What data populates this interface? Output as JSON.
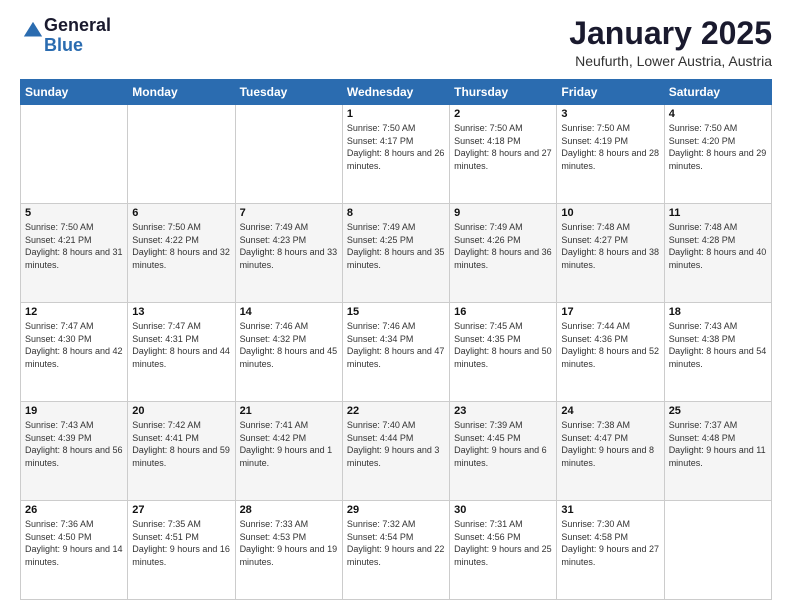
{
  "header": {
    "logo_general": "General",
    "logo_blue": "Blue",
    "month_title": "January 2025",
    "location": "Neufurth, Lower Austria, Austria"
  },
  "days_of_week": [
    "Sunday",
    "Monday",
    "Tuesday",
    "Wednesday",
    "Thursday",
    "Friday",
    "Saturday"
  ],
  "weeks": [
    [
      {
        "day": "",
        "content": ""
      },
      {
        "day": "",
        "content": ""
      },
      {
        "day": "",
        "content": ""
      },
      {
        "day": "1",
        "content": "Sunrise: 7:50 AM\nSunset: 4:17 PM\nDaylight: 8 hours and 26 minutes."
      },
      {
        "day": "2",
        "content": "Sunrise: 7:50 AM\nSunset: 4:18 PM\nDaylight: 8 hours and 27 minutes."
      },
      {
        "day": "3",
        "content": "Sunrise: 7:50 AM\nSunset: 4:19 PM\nDaylight: 8 hours and 28 minutes."
      },
      {
        "day": "4",
        "content": "Sunrise: 7:50 AM\nSunset: 4:20 PM\nDaylight: 8 hours and 29 minutes."
      }
    ],
    [
      {
        "day": "5",
        "content": "Sunrise: 7:50 AM\nSunset: 4:21 PM\nDaylight: 8 hours and 31 minutes."
      },
      {
        "day": "6",
        "content": "Sunrise: 7:50 AM\nSunset: 4:22 PM\nDaylight: 8 hours and 32 minutes."
      },
      {
        "day": "7",
        "content": "Sunrise: 7:49 AM\nSunset: 4:23 PM\nDaylight: 8 hours and 33 minutes."
      },
      {
        "day": "8",
        "content": "Sunrise: 7:49 AM\nSunset: 4:25 PM\nDaylight: 8 hours and 35 minutes."
      },
      {
        "day": "9",
        "content": "Sunrise: 7:49 AM\nSunset: 4:26 PM\nDaylight: 8 hours and 36 minutes."
      },
      {
        "day": "10",
        "content": "Sunrise: 7:48 AM\nSunset: 4:27 PM\nDaylight: 8 hours and 38 minutes."
      },
      {
        "day": "11",
        "content": "Sunrise: 7:48 AM\nSunset: 4:28 PM\nDaylight: 8 hours and 40 minutes."
      }
    ],
    [
      {
        "day": "12",
        "content": "Sunrise: 7:47 AM\nSunset: 4:30 PM\nDaylight: 8 hours and 42 minutes."
      },
      {
        "day": "13",
        "content": "Sunrise: 7:47 AM\nSunset: 4:31 PM\nDaylight: 8 hours and 44 minutes."
      },
      {
        "day": "14",
        "content": "Sunrise: 7:46 AM\nSunset: 4:32 PM\nDaylight: 8 hours and 45 minutes."
      },
      {
        "day": "15",
        "content": "Sunrise: 7:46 AM\nSunset: 4:34 PM\nDaylight: 8 hours and 47 minutes."
      },
      {
        "day": "16",
        "content": "Sunrise: 7:45 AM\nSunset: 4:35 PM\nDaylight: 8 hours and 50 minutes."
      },
      {
        "day": "17",
        "content": "Sunrise: 7:44 AM\nSunset: 4:36 PM\nDaylight: 8 hours and 52 minutes."
      },
      {
        "day": "18",
        "content": "Sunrise: 7:43 AM\nSunset: 4:38 PM\nDaylight: 8 hours and 54 minutes."
      }
    ],
    [
      {
        "day": "19",
        "content": "Sunrise: 7:43 AM\nSunset: 4:39 PM\nDaylight: 8 hours and 56 minutes."
      },
      {
        "day": "20",
        "content": "Sunrise: 7:42 AM\nSunset: 4:41 PM\nDaylight: 8 hours and 59 minutes."
      },
      {
        "day": "21",
        "content": "Sunrise: 7:41 AM\nSunset: 4:42 PM\nDaylight: 9 hours and 1 minute."
      },
      {
        "day": "22",
        "content": "Sunrise: 7:40 AM\nSunset: 4:44 PM\nDaylight: 9 hours and 3 minutes."
      },
      {
        "day": "23",
        "content": "Sunrise: 7:39 AM\nSunset: 4:45 PM\nDaylight: 9 hours and 6 minutes."
      },
      {
        "day": "24",
        "content": "Sunrise: 7:38 AM\nSunset: 4:47 PM\nDaylight: 9 hours and 8 minutes."
      },
      {
        "day": "25",
        "content": "Sunrise: 7:37 AM\nSunset: 4:48 PM\nDaylight: 9 hours and 11 minutes."
      }
    ],
    [
      {
        "day": "26",
        "content": "Sunrise: 7:36 AM\nSunset: 4:50 PM\nDaylight: 9 hours and 14 minutes."
      },
      {
        "day": "27",
        "content": "Sunrise: 7:35 AM\nSunset: 4:51 PM\nDaylight: 9 hours and 16 minutes."
      },
      {
        "day": "28",
        "content": "Sunrise: 7:33 AM\nSunset: 4:53 PM\nDaylight: 9 hours and 19 minutes."
      },
      {
        "day": "29",
        "content": "Sunrise: 7:32 AM\nSunset: 4:54 PM\nDaylight: 9 hours and 22 minutes."
      },
      {
        "day": "30",
        "content": "Sunrise: 7:31 AM\nSunset: 4:56 PM\nDaylight: 9 hours and 25 minutes."
      },
      {
        "day": "31",
        "content": "Sunrise: 7:30 AM\nSunset: 4:58 PM\nDaylight: 9 hours and 27 minutes."
      },
      {
        "day": "",
        "content": ""
      }
    ]
  ]
}
